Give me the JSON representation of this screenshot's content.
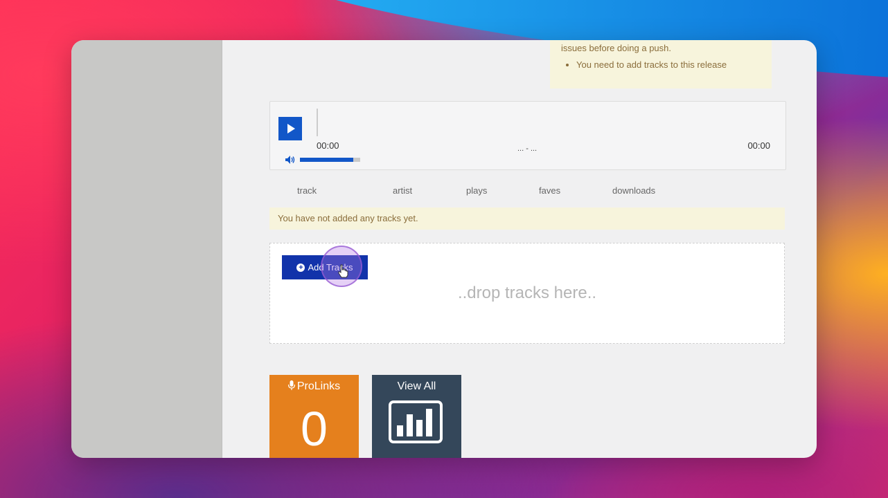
{
  "warning": {
    "line1": "issues before doing a push.",
    "items": [
      "You need to add tracks to this release"
    ]
  },
  "player": {
    "time_current": "00:00",
    "track_title": "... - ...",
    "time_total": "00:00",
    "volume_percent": 88
  },
  "columns": [
    "track",
    "artist",
    "plays",
    "faves",
    "downloads"
  ],
  "empty_message": "You have not added any tracks yet.",
  "dropzone": {
    "add_button": "Add Tracks",
    "placeholder": "..drop tracks here.."
  },
  "tiles": {
    "prolinks_label": "ProLinks",
    "prolinks_count": "0",
    "view_all_label": "View All"
  },
  "colors": {
    "primary_blue": "#1257c8",
    "button_blue": "#1133aa",
    "orange": "#e5801d",
    "dark_tile": "#34475a",
    "alert_bg": "#f7f4dc"
  }
}
